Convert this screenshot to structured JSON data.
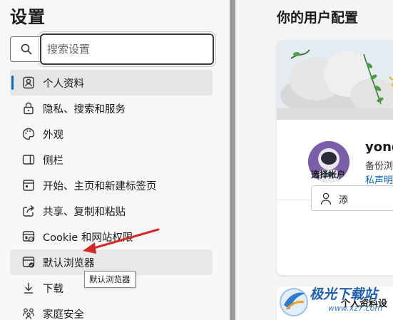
{
  "sidebar": {
    "title": "设置",
    "search": {
      "placeholder": "搜索设置",
      "value": ""
    },
    "items": [
      {
        "label": "个人资料",
        "icon": "profile-icon",
        "state": "selected"
      },
      {
        "label": "隐私、搜索和服务",
        "icon": "lock-icon"
      },
      {
        "label": "外观",
        "icon": "palette-icon"
      },
      {
        "label": "侧栏",
        "icon": "sidebar-icon"
      },
      {
        "label": "开始、主页和新建标签页",
        "icon": "home-page-icon"
      },
      {
        "label": "共享、复制和粘贴",
        "icon": "share-icon"
      },
      {
        "label": "Cookie 和网站权限",
        "icon": "site-permissions-icon"
      },
      {
        "label": "默认浏览器",
        "icon": "default-browser-icon",
        "state": "hover"
      },
      {
        "label": "下载",
        "icon": "download-icon"
      },
      {
        "label": "家庭安全",
        "icon": "family-icon"
      }
    ],
    "tooltip": "默认浏览器"
  },
  "main": {
    "heading": "你的用户配置",
    "profile": {
      "name": "yong",
      "backup_text": "备份浏",
      "privacy_link": "私声明"
    },
    "choose_account_label": "选择帐户",
    "add_button_label": "添",
    "personal_settings_label": "个人资料设"
  },
  "watermark": {
    "text": "极光下载站",
    "url": "www.xz7.com"
  },
  "colors": {
    "accent": "#0f6cbd",
    "annotation_arrow": "#d42a2a",
    "avatar_bg": "#7a5fa8"
  }
}
